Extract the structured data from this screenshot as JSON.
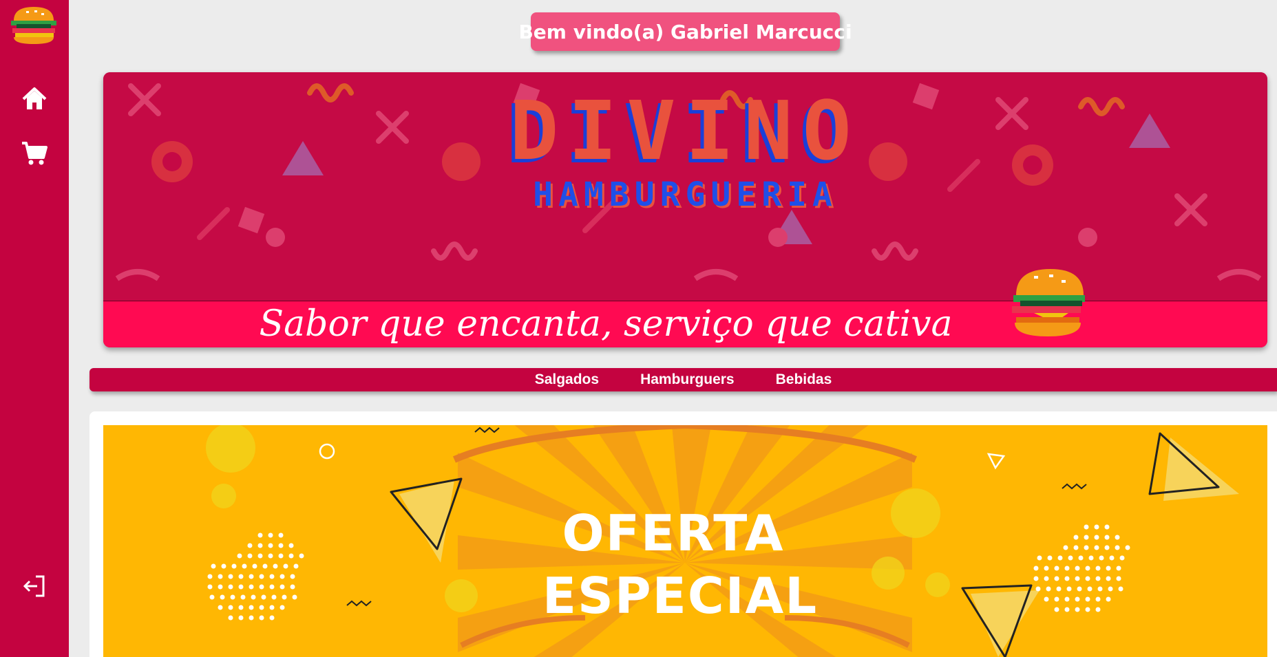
{
  "sidebar": {
    "logo_icon": "burger-logo-icon",
    "items": [
      {
        "icon": "home-icon"
      },
      {
        "icon": "cart-icon"
      },
      {
        "icon": "logout-icon"
      }
    ]
  },
  "header": {
    "welcome": "Bem vindo(a) Gabriel Marcucci"
  },
  "banner": {
    "brand": "DIVINO",
    "subtitle": "HAMBURGUERIA",
    "slogan": "Sabor que encanta, serviço que cativa"
  },
  "categories": [
    "Salgados",
    "Hamburguers",
    "Bebidas"
  ],
  "promo": {
    "line1": "OFERTA",
    "line2": "ESPECIAL"
  },
  "colors": {
    "brand": "#c40340",
    "welcome_bg": "#f0527f",
    "slogan_bar": "#ff0a52",
    "promo_bg": "#ffb703"
  }
}
